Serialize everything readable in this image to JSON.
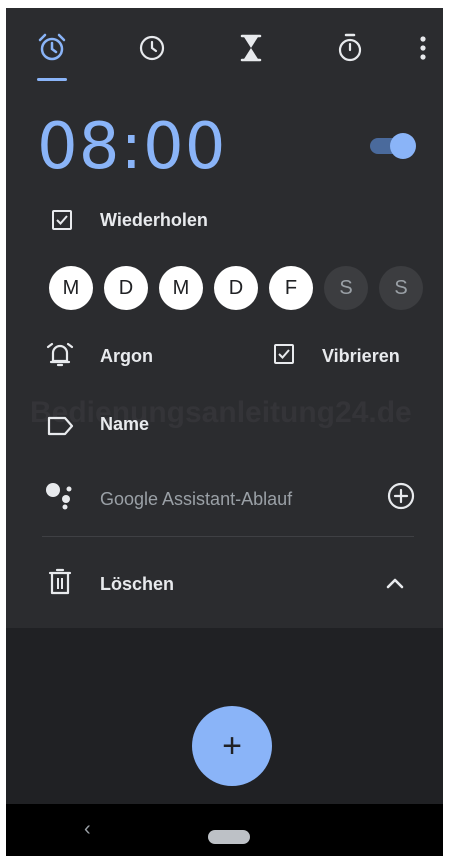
{
  "tabs": [
    {
      "icon": "alarm-icon",
      "active": true
    },
    {
      "icon": "clock-icon",
      "active": false
    },
    {
      "icon": "timer-icon",
      "active": false
    },
    {
      "icon": "stopwatch-icon",
      "active": false
    }
  ],
  "alarm": {
    "time": "08:00",
    "enabled": true,
    "repeat_label": "Wiederholen",
    "repeat_checked": true,
    "days": [
      {
        "label": "M",
        "selected": true
      },
      {
        "label": "D",
        "selected": true
      },
      {
        "label": "M",
        "selected": true
      },
      {
        "label": "D",
        "selected": true
      },
      {
        "label": "F",
        "selected": true
      },
      {
        "label": "S",
        "selected": false
      },
      {
        "label": "S",
        "selected": false
      }
    ],
    "sound_label": "Argon",
    "vibrate_label": "Vibrieren",
    "vibrate_checked": true,
    "name_label": "Name",
    "assistant_label": "Google Assistant-Ablauf",
    "delete_label": "Löschen"
  },
  "watermark": "Bedienungsanleitung24.de",
  "fab": {
    "label": "+"
  },
  "navbar": {
    "back": "‹"
  },
  "colors": {
    "accent": "#8ab4f8",
    "card": "#2b2c2f",
    "background": "#202124"
  }
}
